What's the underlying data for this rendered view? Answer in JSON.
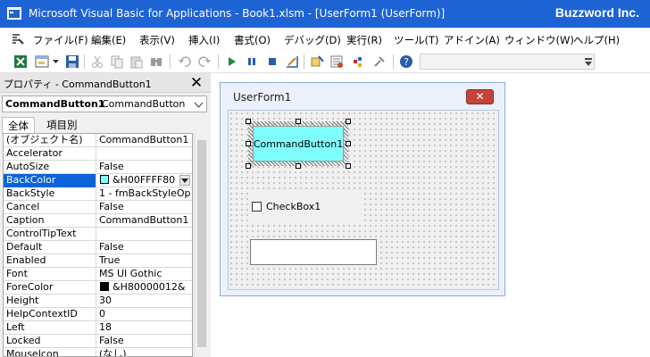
{
  "window": {
    "title": "Microsoft Visual Basic for Applications - Book1.xlsm - [UserForm1 (UserForm)]",
    "watermark": "Buzzword Inc."
  },
  "menubar": {
    "items": [
      "ファイル(F)",
      "編集(E)",
      "表示(V)",
      "挿入(I)",
      "書式(O)",
      "デバッグ(D)",
      "実行(R)",
      "ツール(T)",
      "アドイン(A)",
      "ウィンドウ(W)",
      "ヘルプ(H)"
    ]
  },
  "properties": {
    "header": "プロパティ - CommandButton1",
    "object_name": "CommandButton1",
    "object_type": "CommandButton",
    "tabs": [
      "全体",
      "項目別"
    ],
    "rows": [
      {
        "key": "(オブジェクト名)",
        "value": "CommandButton1"
      },
      {
        "key": "Accelerator",
        "value": ""
      },
      {
        "key": "AutoSize",
        "value": "False"
      },
      {
        "key": "BackColor",
        "value": "&H00FFFF80"
      },
      {
        "key": "BackStyle",
        "value": "1 - fmBackStyleOp"
      },
      {
        "key": "Cancel",
        "value": "False"
      },
      {
        "key": "Caption",
        "value": "CommandButton1"
      },
      {
        "key": "ControlTipText",
        "value": ""
      },
      {
        "key": "Default",
        "value": "False"
      },
      {
        "key": "Enabled",
        "value": "True"
      },
      {
        "key": "Font",
        "value": "MS UI Gothic"
      },
      {
        "key": "ForeColor",
        "value": "&H80000012&"
      },
      {
        "key": "Height",
        "value": "30"
      },
      {
        "key": "HelpContextID",
        "value": "0"
      },
      {
        "key": "Left",
        "value": "18"
      },
      {
        "key": "Locked",
        "value": "False"
      },
      {
        "key": "MouseIcon",
        "value": "(なし)"
      }
    ],
    "backcolor_swatch": "#80FFFF",
    "forecolor_swatch": "#000000"
  },
  "designer": {
    "form_title": "UserForm1",
    "command_button": "CommandButton1",
    "checkbox": "CheckBox1"
  },
  "colors": {
    "titlebar": "#1e63d4",
    "selection": "#0a64d8",
    "button_fill": "#80ffff",
    "close_button": "#c7423a"
  }
}
